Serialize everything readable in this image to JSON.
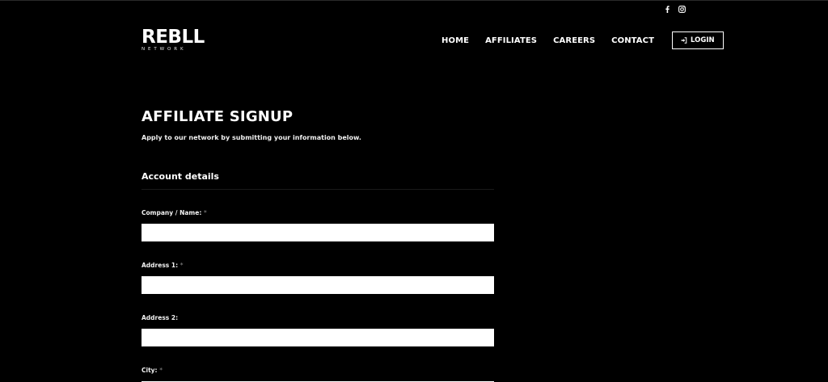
{
  "social": {
    "facebook_icon": "facebook-icon",
    "instagram_icon": "instagram-icon"
  },
  "header": {
    "logo_main": "REBLL",
    "logo_sub": "NETWORK",
    "nav": [
      {
        "label": "HOME"
      },
      {
        "label": "AFFILIATES"
      },
      {
        "label": "CAREERS"
      },
      {
        "label": "CONTACT"
      }
    ],
    "login_label": "LOGIN",
    "login_icon": "sign-in-icon"
  },
  "main": {
    "title": "AFFILIATE SIGNUP",
    "subtitle": "Apply to our network by submitting your information below.",
    "section_title": "Account details",
    "fields": [
      {
        "label": "Company / Name:",
        "required_mark": "*",
        "value": ""
      },
      {
        "label": "Address 1:",
        "required_mark": "*",
        "value": ""
      },
      {
        "label": "Address 2:",
        "required_mark": "",
        "value": ""
      },
      {
        "label": "City:",
        "required_mark": "*",
        "value": ""
      }
    ]
  },
  "colors": {
    "background": "#000000",
    "text": "#ffffff",
    "input_bg": "#ffffff",
    "required_mark": "#8a8a8a"
  }
}
